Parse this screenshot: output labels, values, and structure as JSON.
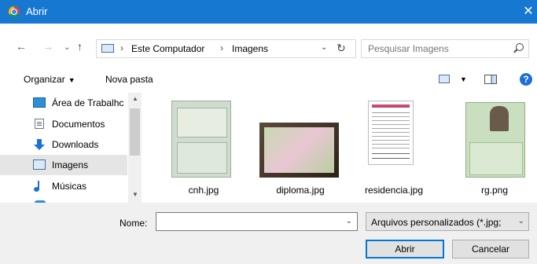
{
  "window": {
    "title": "Abrir",
    "close_glyph": "✕"
  },
  "nav": {
    "back_glyph": "←",
    "forward_glyph": "→",
    "recent_glyph": "⌄",
    "up_glyph": "↑",
    "breadcrumb": [
      "Este Computador",
      "Imagens"
    ],
    "breadcrumb_sep": "›",
    "address_dropdown_glyph": "⌄",
    "refresh_glyph": "↻",
    "search_placeholder": "Pesquisar Imagens"
  },
  "toolbar": {
    "organize_label": "Organizar",
    "organize_caret": "▼",
    "new_folder_label": "Nova pasta",
    "view_caret": "▼",
    "help_glyph": "?"
  },
  "sidebar": {
    "items": [
      {
        "label": "Área de Trabalhc",
        "icon": "desktop-icon"
      },
      {
        "label": "Documentos",
        "icon": "documents-icon"
      },
      {
        "label": "Downloads",
        "icon": "downloads-icon"
      },
      {
        "label": "Imagens",
        "icon": "pictures-icon",
        "selected": true
      },
      {
        "label": "Músicas",
        "icon": "music-icon"
      }
    ],
    "scroll_up_glyph": "▲",
    "scroll_down_glyph": "▼"
  },
  "files": [
    {
      "name": "cnh.jpg"
    },
    {
      "name": "diploma.jpg"
    },
    {
      "name": "residencia.jpg"
    },
    {
      "name": "rg.png"
    }
  ],
  "footer": {
    "name_label": "Nome:",
    "name_value": "",
    "name_dropdown_glyph": "⌄",
    "filetype_value": "Arquivos personalizados (*.jpg;",
    "filetype_dropdown_glyph": "⌄",
    "open_label": "Abrir",
    "cancel_label": "Cancelar"
  },
  "colors": {
    "titlebar": "#1778d2",
    "selection": "#e5e5e5",
    "accent_border": "#0078d7"
  }
}
